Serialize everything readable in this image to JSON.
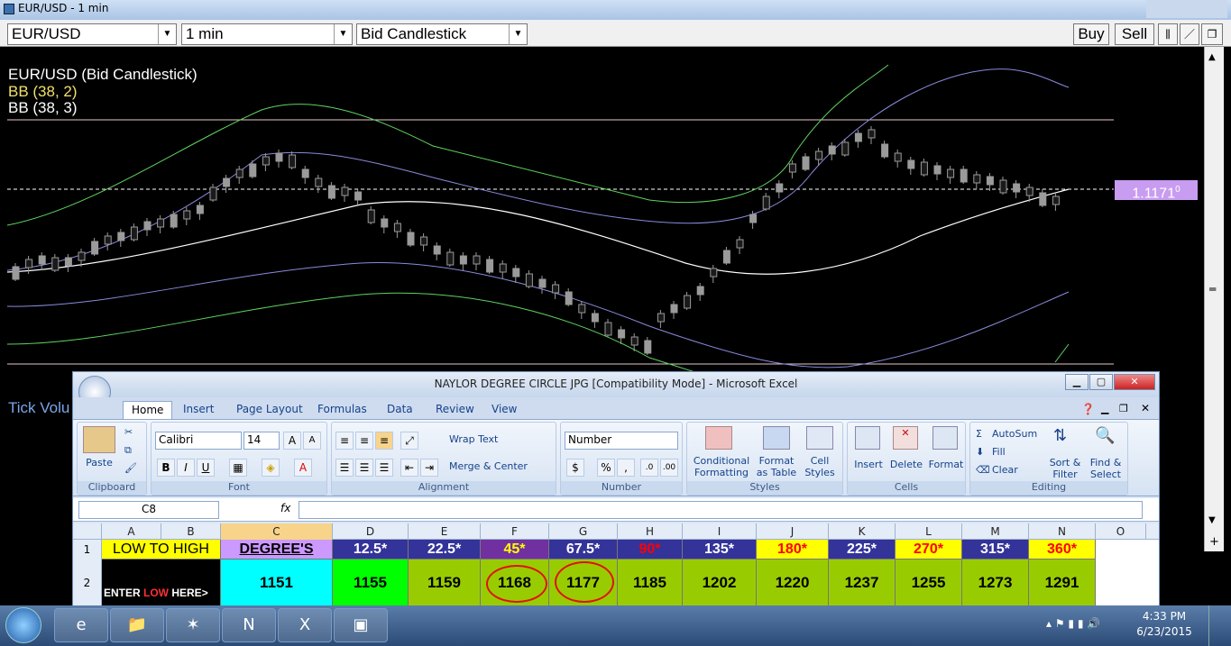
{
  "chart_window": {
    "title": "EUR/USD - 1 min",
    "symbol_select": "EUR/USD",
    "interval_select": "1 min",
    "chart_type_select": "Bid Candlestick",
    "buy_label": "Buy",
    "sell_label": "Sell",
    "legend_title": "EUR/USD (Bid Candlestick)",
    "bb1_label": "BB (38, 2)",
    "bb2_label": "BB (38, 3)",
    "price_tag": "1.1171",
    "price_tag_sup": "0",
    "tick_volume_label": "Tick Volu",
    "colors": {
      "bb1": "#5fd35f",
      "bb2": "#8a8adf",
      "mid": "#ffffff",
      "candle": "#9a9a9a",
      "tag": "#c89cf0"
    }
  },
  "excel": {
    "title": "NAYLOR DEGREE CIRCLE JPG  [Compatibility Mode] - Microsoft Excel",
    "tabs": [
      "Home",
      "Insert",
      "Page Layout",
      "Formulas",
      "Data",
      "Review",
      "View"
    ],
    "ribbon": {
      "clipboard": {
        "paste": "Paste",
        "label": "Clipboard"
      },
      "font": {
        "name": "Calibri",
        "size": "14",
        "label": "Font"
      },
      "alignment": {
        "wrap": "Wrap Text",
        "merge": "Merge & Center",
        "label": "Alignment"
      },
      "number": {
        "format": "Number",
        "label": "Number",
        "dollar": "$",
        "percent": "%",
        "comma": ","
      },
      "styles": {
        "conditional": "Conditional Formatting",
        "format_table": "Format as Table",
        "cell_styles": "Cell Styles",
        "label": "Styles"
      },
      "cells": {
        "insert": "Insert",
        "delete": "Delete",
        "format": "Format",
        "label": "Cells"
      },
      "editing": {
        "autosum": "AutoSum",
        "fill": "Fill",
        "clear": "Clear",
        "sort": "Sort & Filter",
        "find": "Find & Select",
        "label": "Editing"
      }
    },
    "name_box": "C8",
    "fx": "fx",
    "columns": [
      "A",
      "B",
      "C",
      "D",
      "E",
      "F",
      "G",
      "H",
      "I",
      "J",
      "K",
      "L",
      "M",
      "N",
      "O"
    ],
    "row_numbers": [
      "1",
      "2"
    ],
    "row1": {
      "low_to_high": "LOW TO HIGH",
      "degrees_head": "DEGREE'S",
      "degrees": [
        "12.5*",
        "22.5*",
        "45*",
        "67.5*",
        "90*",
        "135*",
        "180*",
        "225*",
        "270*",
        "315*",
        "360*"
      ]
    },
    "row2": {
      "enter_prefix": "ENTER ",
      "enter_low": "LOW",
      "enter_suffix": " HERE>",
      "values": [
        "1151",
        "1155",
        "1159",
        "1168",
        "1177",
        "1185",
        "1202",
        "1220",
        "1237",
        "1255",
        "1273",
        "1291"
      ]
    }
  },
  "taskbar": {
    "time": "4:33 PM",
    "date": "6/23/2015"
  }
}
